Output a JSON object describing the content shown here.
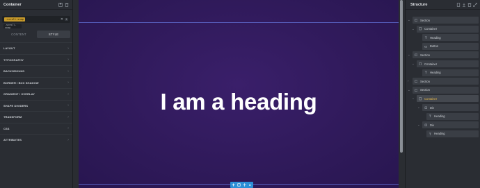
{
  "left_panel": {
    "title": "Container",
    "class_chip": ".scroll-snap",
    "class_count": "1",
    "class_sub": ".scroll-snap",
    "tabs": [
      "CONTENT",
      "STYLE"
    ],
    "sections": [
      "LAYOUT",
      "TYPOGRAPHY",
      "BACKGROUND",
      "BORDER / BOX SHADOW",
      "GRADIENT / OVERLAY",
      "SHAPE DIVIDERS",
      "TRANSFORM",
      "CSS",
      "ATTRIBUTES"
    ]
  },
  "canvas": {
    "heading": "I am a heading",
    "toolbar_icons": [
      "add-icon",
      "copy-icon",
      "move-icon",
      "drag-icon"
    ]
  },
  "structure": {
    "title": "Structure",
    "nodes": [
      {
        "label": "Section",
        "icon": "section-icon",
        "depth": 0,
        "caret": "down"
      },
      {
        "label": "Container",
        "icon": "container-icon",
        "depth": 1,
        "caret": "down"
      },
      {
        "label": "Heading",
        "icon": "heading-icon",
        "depth": 2,
        "caret": ""
      },
      {
        "label": "Button",
        "icon": "button-icon",
        "depth": 2,
        "caret": ""
      },
      {
        "label": "Section",
        "icon": "section-icon",
        "depth": 0,
        "caret": "down"
      },
      {
        "label": "Container",
        "icon": "container-icon",
        "depth": 1,
        "caret": "down"
      },
      {
        "label": "Heading",
        "icon": "heading-icon",
        "depth": 2,
        "caret": ""
      },
      {
        "label": "Section",
        "icon": "section-icon",
        "depth": 0,
        "caret": "right"
      },
      {
        "label": "Section",
        "icon": "section-icon",
        "depth": 0,
        "caret": "down"
      },
      {
        "label": "Container",
        "icon": "container-icon",
        "depth": 1,
        "caret": "down",
        "active": true
      },
      {
        "label": "Div",
        "icon": "div-icon",
        "depth": 2,
        "caret": "down"
      },
      {
        "label": "Heading",
        "icon": "heading-icon",
        "depth": 3,
        "caret": ""
      },
      {
        "label": "Div",
        "icon": "div-icon",
        "depth": 2,
        "caret": "down"
      },
      {
        "label": "Heading",
        "icon": "heading-icon",
        "depth": 3,
        "caret": ""
      }
    ]
  },
  "colors": {
    "accent": "#e8b94a",
    "toolbar": "#2d8fd6",
    "canvas_bg": "#301a5b"
  }
}
